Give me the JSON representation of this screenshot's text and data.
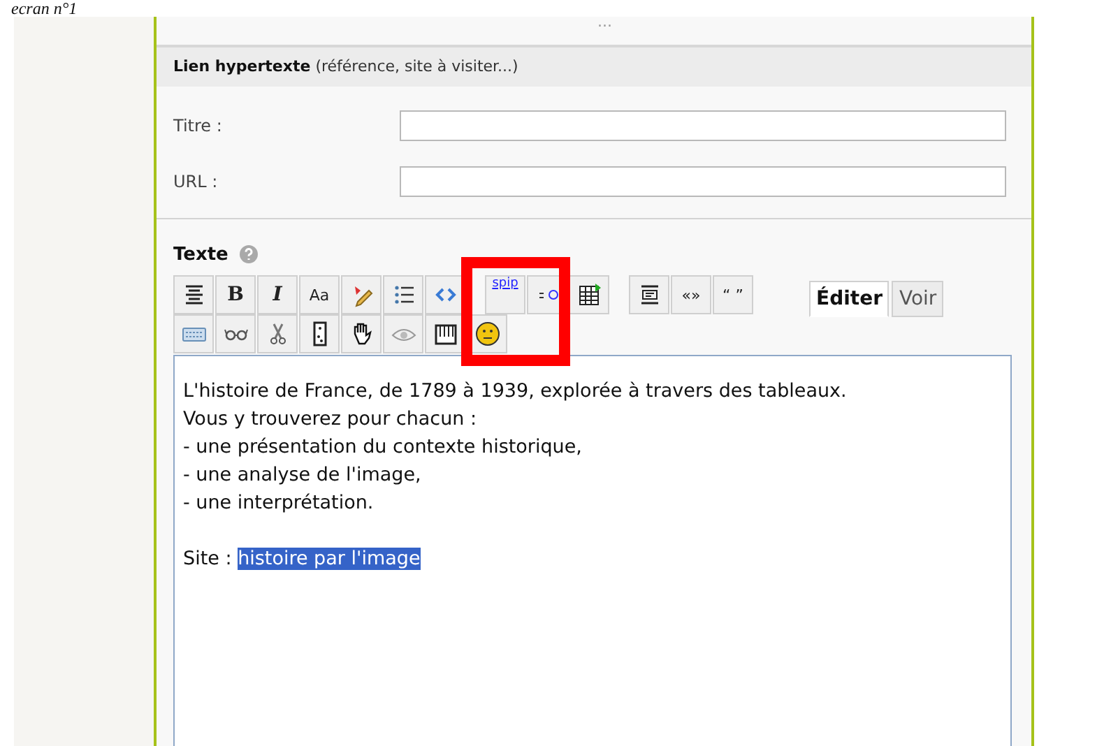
{
  "caption": "ecran n°1",
  "ellipsis": "...",
  "section": {
    "title": "Lien hypertexte",
    "hint": "(référence, site à visiter...)"
  },
  "fields": [
    {
      "label": "Titre :"
    },
    {
      "label": "URL :"
    }
  ],
  "text_section": {
    "label": "Texte"
  },
  "toolbar": [
    [
      {
        "kind": "align"
      },
      {
        "kind": "bold",
        "label": "B"
      },
      {
        "kind": "italic",
        "label": "I"
      },
      {
        "kind": "plain",
        "label": "Aa"
      },
      {
        "kind": "pencil"
      },
      {
        "kind": "list"
      },
      {
        "kind": "code"
      },
      {
        "kind": "gap"
      },
      {
        "kind": "link",
        "label": "spip"
      },
      {
        "kind": "link2"
      },
      {
        "kind": "table"
      },
      {
        "kind": "gap"
      },
      {
        "kind": "para"
      },
      {
        "kind": "plain",
        "label": "«»"
      },
      {
        "kind": "plain",
        "label": "“ ”"
      }
    ],
    [
      {
        "kind": "keyboard"
      },
      {
        "kind": "glasses"
      },
      {
        "kind": "scissors"
      },
      {
        "kind": "domino"
      },
      {
        "kind": "hand"
      },
      {
        "kind": "eye"
      },
      {
        "kind": "ruler"
      },
      {
        "kind": "smiley"
      }
    ]
  ],
  "tabs": [
    {
      "label": "Éditer",
      "selected": true
    },
    {
      "label": "Voir",
      "selected": false
    }
  ],
  "editor": {
    "lines": [
      "L'histoire de France, de 1789 à 1939,  explorée à travers des tableaux.",
      "Vous y trouverez pour chacun :",
      "- une présentation du contexte historique,",
      "- une analyse de l'image,",
      "- une interprétation."
    ],
    "site_label": "Site :",
    "site_value": "histoire par l'image",
    "site_selected": true
  }
}
